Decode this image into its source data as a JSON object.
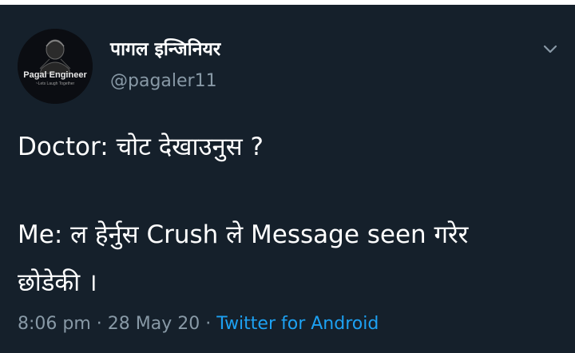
{
  "tweet": {
    "author": {
      "display_name": "पागल इन्जिनियर",
      "handle": "@pagaler11",
      "avatar": {
        "name_text": "Pagal Engineer",
        "tagline_text": "~Lets Laugh Together"
      }
    },
    "body_lines": [
      "Doctor: चोट देखाउनुस ?",
      "Me: ल हेर्नुस Crush ले Message seen गरेर",
      "छोडेकी ।"
    ],
    "time": "8:06 pm",
    "separator": "·",
    "date": "28 May 20",
    "source": "Twitter for Android",
    "menu_icon": "chevron-down-icon"
  },
  "colors": {
    "background": "#15202b",
    "text_primary": "#ffffff",
    "text_secondary": "#8899a6",
    "link": "#1da1f2"
  }
}
